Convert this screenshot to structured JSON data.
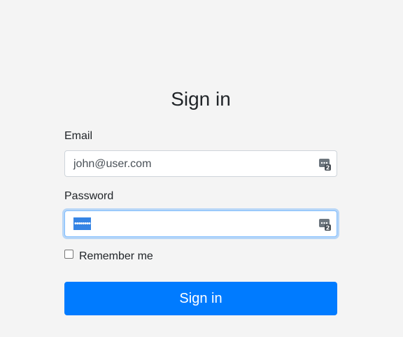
{
  "form": {
    "title": "Sign in",
    "email_label": "Email",
    "email_value": "john@user.com",
    "password_label": "Password",
    "password_value": "••••••••",
    "remember_label": "Remember me",
    "remember_checked": false,
    "submit_label": "Sign in"
  },
  "icons": {
    "email_field_icon": "password-manager-icon",
    "password_field_icon": "password-manager-icon"
  },
  "colors": {
    "background": "#f4f4f4",
    "primary": "#007bff",
    "focus_border": "#80bdff",
    "selection": "#3584e4"
  }
}
